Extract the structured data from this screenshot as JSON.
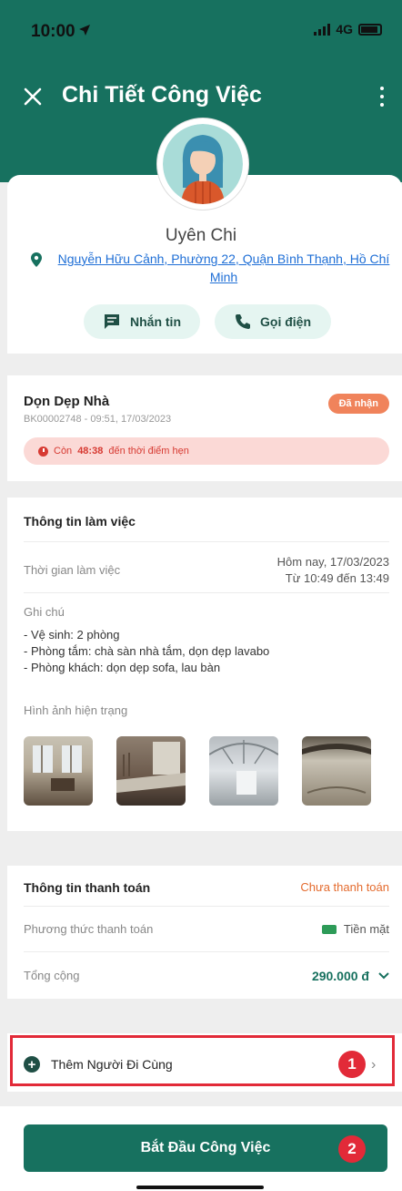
{
  "status_bar": {
    "time": "10:00",
    "network": "4G"
  },
  "header": {
    "title": "Chi Tiết Công Việc"
  },
  "profile": {
    "name": "Uyên Chi",
    "address": "Nguyễn Hữu Cảnh, Phường 22, Quận Bình Thạnh, Hồ Chí Minh",
    "message_label": "Nhắn tin",
    "call_label": "Gọi điện"
  },
  "job": {
    "title": "Dọn Dẹp Nhà",
    "code": "BK00002748 - 09:51, 17/03/2023",
    "status": "Đã nhận",
    "alert_prefix": "Còn",
    "alert_time": "48:38",
    "alert_suffix": "đến thời điểm hẹn"
  },
  "work_info": {
    "title": "Thông tin làm việc",
    "time_label": "Thời gian làm việc",
    "time_value_1": "Hôm nay, 17/03/2023",
    "time_value_2": "Từ 10:49 đến 13:49",
    "note_label": "Ghi chú",
    "notes": [
      "- Vệ sinh: 2 phòng",
      "- Phòng tắm: chà sàn nhà tắm, dọn dẹp lavabo",
      "- Phòng khách: dọn dẹp sofa, lau bàn"
    ],
    "photos_label": "Hình ảnh hiện trạng"
  },
  "payment": {
    "title": "Thông tin thanh toán",
    "status": "Chưa thanh toán",
    "method_label": "Phương thức thanh toán",
    "method_value": "Tiền mặt",
    "total_label": "Tổng cộng",
    "total_value": "290.000 đ"
  },
  "add_companion": {
    "label": "Thêm Người Đi Cùng",
    "badge": "1"
  },
  "start": {
    "label": "Bắt Đầu Công Việc",
    "badge": "2"
  },
  "colors": {
    "primary": "#17715f",
    "accent": "#e46b2e",
    "highlight": "#e22a38"
  }
}
